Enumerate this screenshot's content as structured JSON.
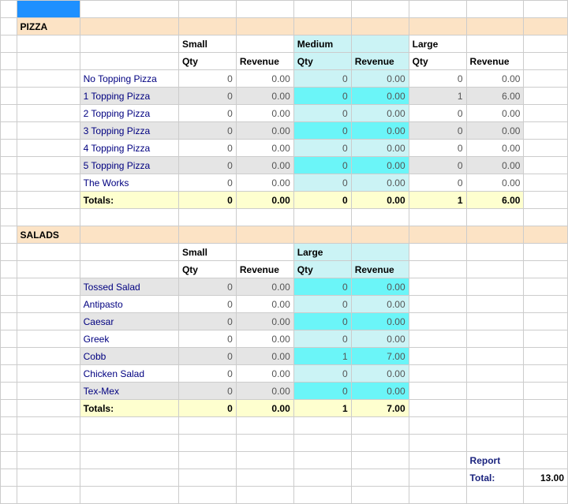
{
  "sections": {
    "pizza": {
      "title": "PIZZA",
      "sizeHeaders": {
        "small": "Small",
        "medium": "Medium",
        "large": "Large"
      },
      "colHeaders": {
        "qty": "Qty",
        "revenue": "Revenue"
      },
      "items": [
        {
          "name": "No Topping Pizza",
          "sQty": "0",
          "sRev": "0.00",
          "mQty": "0",
          "mRev": "0.00",
          "lQty": "0",
          "lRev": "0.00",
          "shade": false
        },
        {
          "name": "1 Topping Pizza",
          "sQty": "0",
          "sRev": "0.00",
          "mQty": "0",
          "mRev": "0.00",
          "lQty": "1",
          "lRev": "6.00",
          "shade": true
        },
        {
          "name": "2 Topping Pizza",
          "sQty": "0",
          "sRev": "0.00",
          "mQty": "0",
          "mRev": "0.00",
          "lQty": "0",
          "lRev": "0.00",
          "shade": false
        },
        {
          "name": "3 Topping Pizza",
          "sQty": "0",
          "sRev": "0.00",
          "mQty": "0",
          "mRev": "0.00",
          "lQty": "0",
          "lRev": "0.00",
          "shade": true
        },
        {
          "name": "4 Topping Pizza",
          "sQty": "0",
          "sRev": "0.00",
          "mQty": "0",
          "mRev": "0.00",
          "lQty": "0",
          "lRev": "0.00",
          "shade": false
        },
        {
          "name": "5 Topping Pizza",
          "sQty": "0",
          "sRev": "0.00",
          "mQty": "0",
          "mRev": "0.00",
          "lQty": "0",
          "lRev": "0.00",
          "shade": true
        },
        {
          "name": "The Works",
          "sQty": "0",
          "sRev": "0.00",
          "mQty": "0",
          "mRev": "0.00",
          "lQty": "0",
          "lRev": "0.00",
          "shade": false
        }
      ],
      "totals": {
        "label": "Totals:",
        "sQty": "0",
        "sRev": "0.00",
        "mQty": "0",
        "mRev": "0.00",
        "lQty": "1",
        "lRev": "6.00"
      }
    },
    "salads": {
      "title": "SALADS",
      "sizeHeaders": {
        "small": "Small",
        "large": "Large"
      },
      "colHeaders": {
        "qty": "Qty",
        "revenue": "Revenue"
      },
      "items": [
        {
          "name": "Tossed Salad",
          "sQty": "0",
          "sRev": "0.00",
          "lQty": "0",
          "lRev": "0.00",
          "shade": true
        },
        {
          "name": "Antipasto",
          "sQty": "0",
          "sRev": "0.00",
          "lQty": "0",
          "lRev": "0.00",
          "shade": false
        },
        {
          "name": "Caesar",
          "sQty": "0",
          "sRev": "0.00",
          "lQty": "0",
          "lRev": "0.00",
          "shade": true
        },
        {
          "name": "Greek",
          "sQty": "0",
          "sRev": "0.00",
          "lQty": "0",
          "lRev": "0.00",
          "shade": false
        },
        {
          "name": "Cobb",
          "sQty": "0",
          "sRev": "0.00",
          "lQty": "1",
          "lRev": "7.00",
          "shade": true
        },
        {
          "name": "Chicken Salad",
          "sQty": "0",
          "sRev": "0.00",
          "lQty": "0",
          "lRev": "0.00",
          "shade": false
        },
        {
          "name": "Tex-Mex",
          "sQty": "0",
          "sRev": "0.00",
          "lQty": "0",
          "lRev": "0.00",
          "shade": true
        }
      ],
      "totals": {
        "label": "Totals:",
        "sQty": "0",
        "sRev": "0.00",
        "lQty": "1",
        "lRev": "7.00"
      }
    }
  },
  "report": {
    "label": "Report",
    "totalLabel": "Total:",
    "totalValue": "13.00"
  }
}
